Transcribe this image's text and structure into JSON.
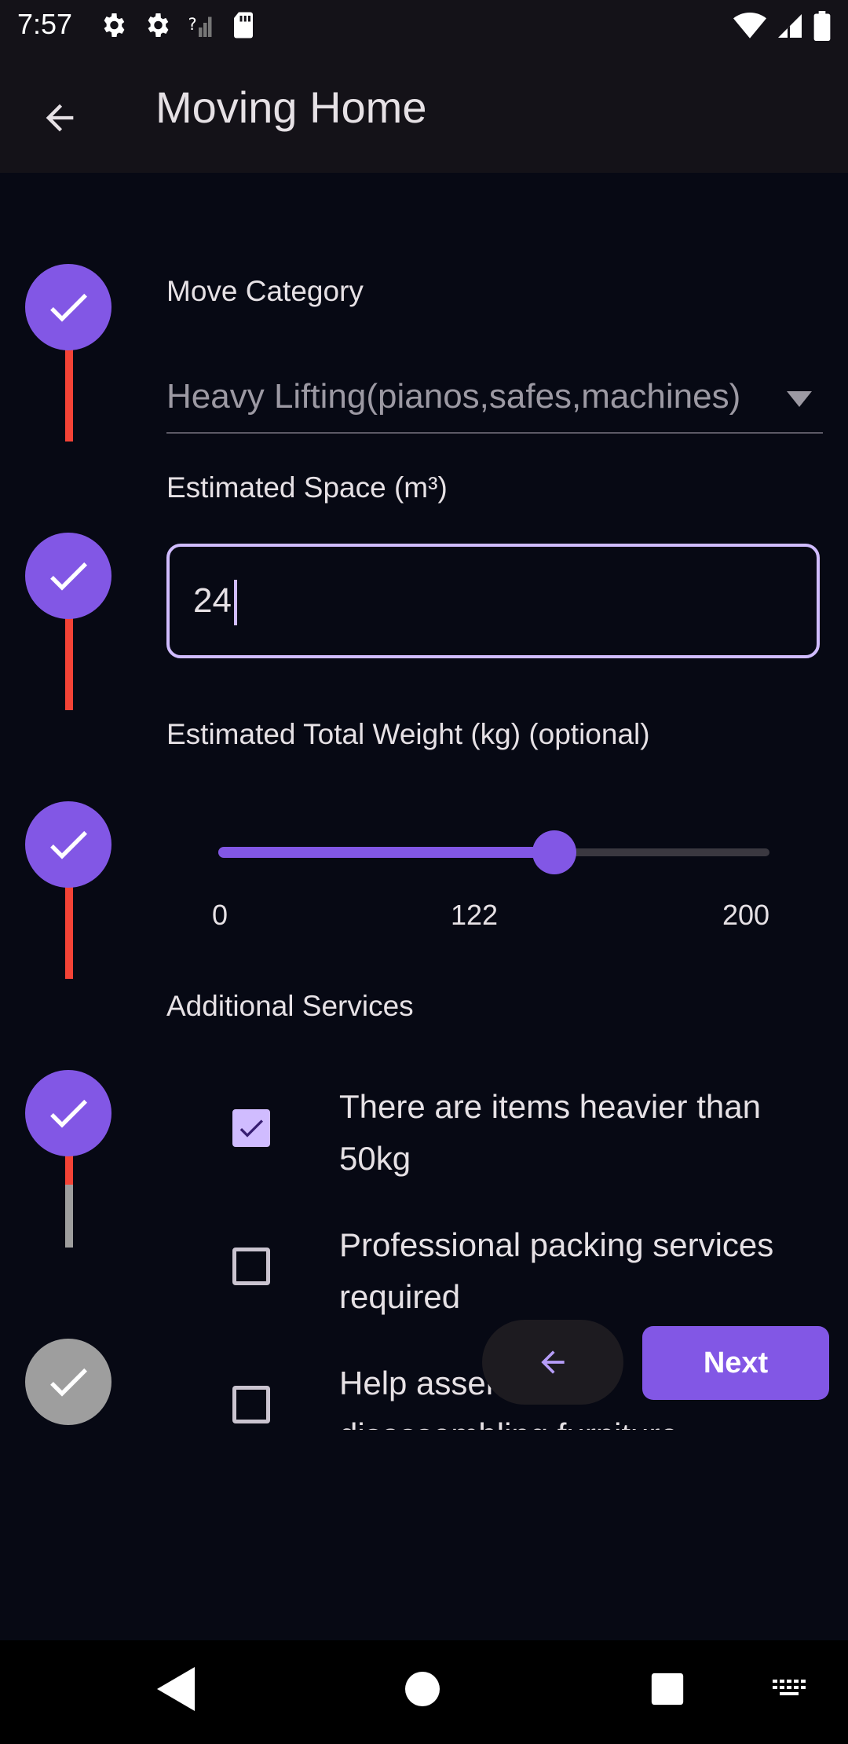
{
  "status_bar": {
    "time": "7:57",
    "left_icons": [
      "settings-icon",
      "settings-icon",
      "no-signal-icon",
      "sd-card-icon"
    ],
    "right_icons": [
      "wifi-icon",
      "signal-icon",
      "battery-icon"
    ]
  },
  "app_bar": {
    "title": "Moving Home",
    "back_icon": "arrow-back-icon"
  },
  "stepper": {
    "steps": [
      {
        "state": "done",
        "icon": "check-icon"
      },
      {
        "state": "done",
        "icon": "check-icon"
      },
      {
        "state": "done",
        "icon": "check-icon"
      },
      {
        "state": "done",
        "icon": "check-icon"
      },
      {
        "state": "pending",
        "icon": "check-icon"
      }
    ],
    "colors": {
      "done": "#8257e5",
      "pending": "#9e9e9e",
      "line_done": "#f44336",
      "line_pending": "#9e9e9e"
    }
  },
  "form": {
    "move_category": {
      "label": "Move Category",
      "value": "Heavy Lifting(pianos,safes,machines)"
    },
    "estimated_space": {
      "label": "Estimated Space (m³)",
      "value": "24"
    },
    "estimated_weight": {
      "label": "Estimated Total Weight (kg) (optional)",
      "min_label": "0",
      "value_label": "122",
      "max_label": "200",
      "min": 0,
      "max": 200,
      "value": 122
    },
    "additional_services": {
      "label": "Additional Services",
      "options": [
        {
          "label": "There are items heavier than 50kg",
          "checked": true
        },
        {
          "label": "Professional packing services required",
          "checked": false
        },
        {
          "label": "Help assembling disassembling furniture",
          "checked": false
        }
      ]
    }
  },
  "actions": {
    "back_icon": "arrow-back-icon",
    "next_label": "Next"
  },
  "nav_bar": {
    "icons": [
      "back-triangle-icon",
      "home-circle-icon",
      "recents-square-icon",
      "keyboard-icon"
    ]
  },
  "theme": {
    "accent": "#8257e5",
    "accent_light": "#d0bcff",
    "background": "#070914",
    "bar": "#141218"
  }
}
